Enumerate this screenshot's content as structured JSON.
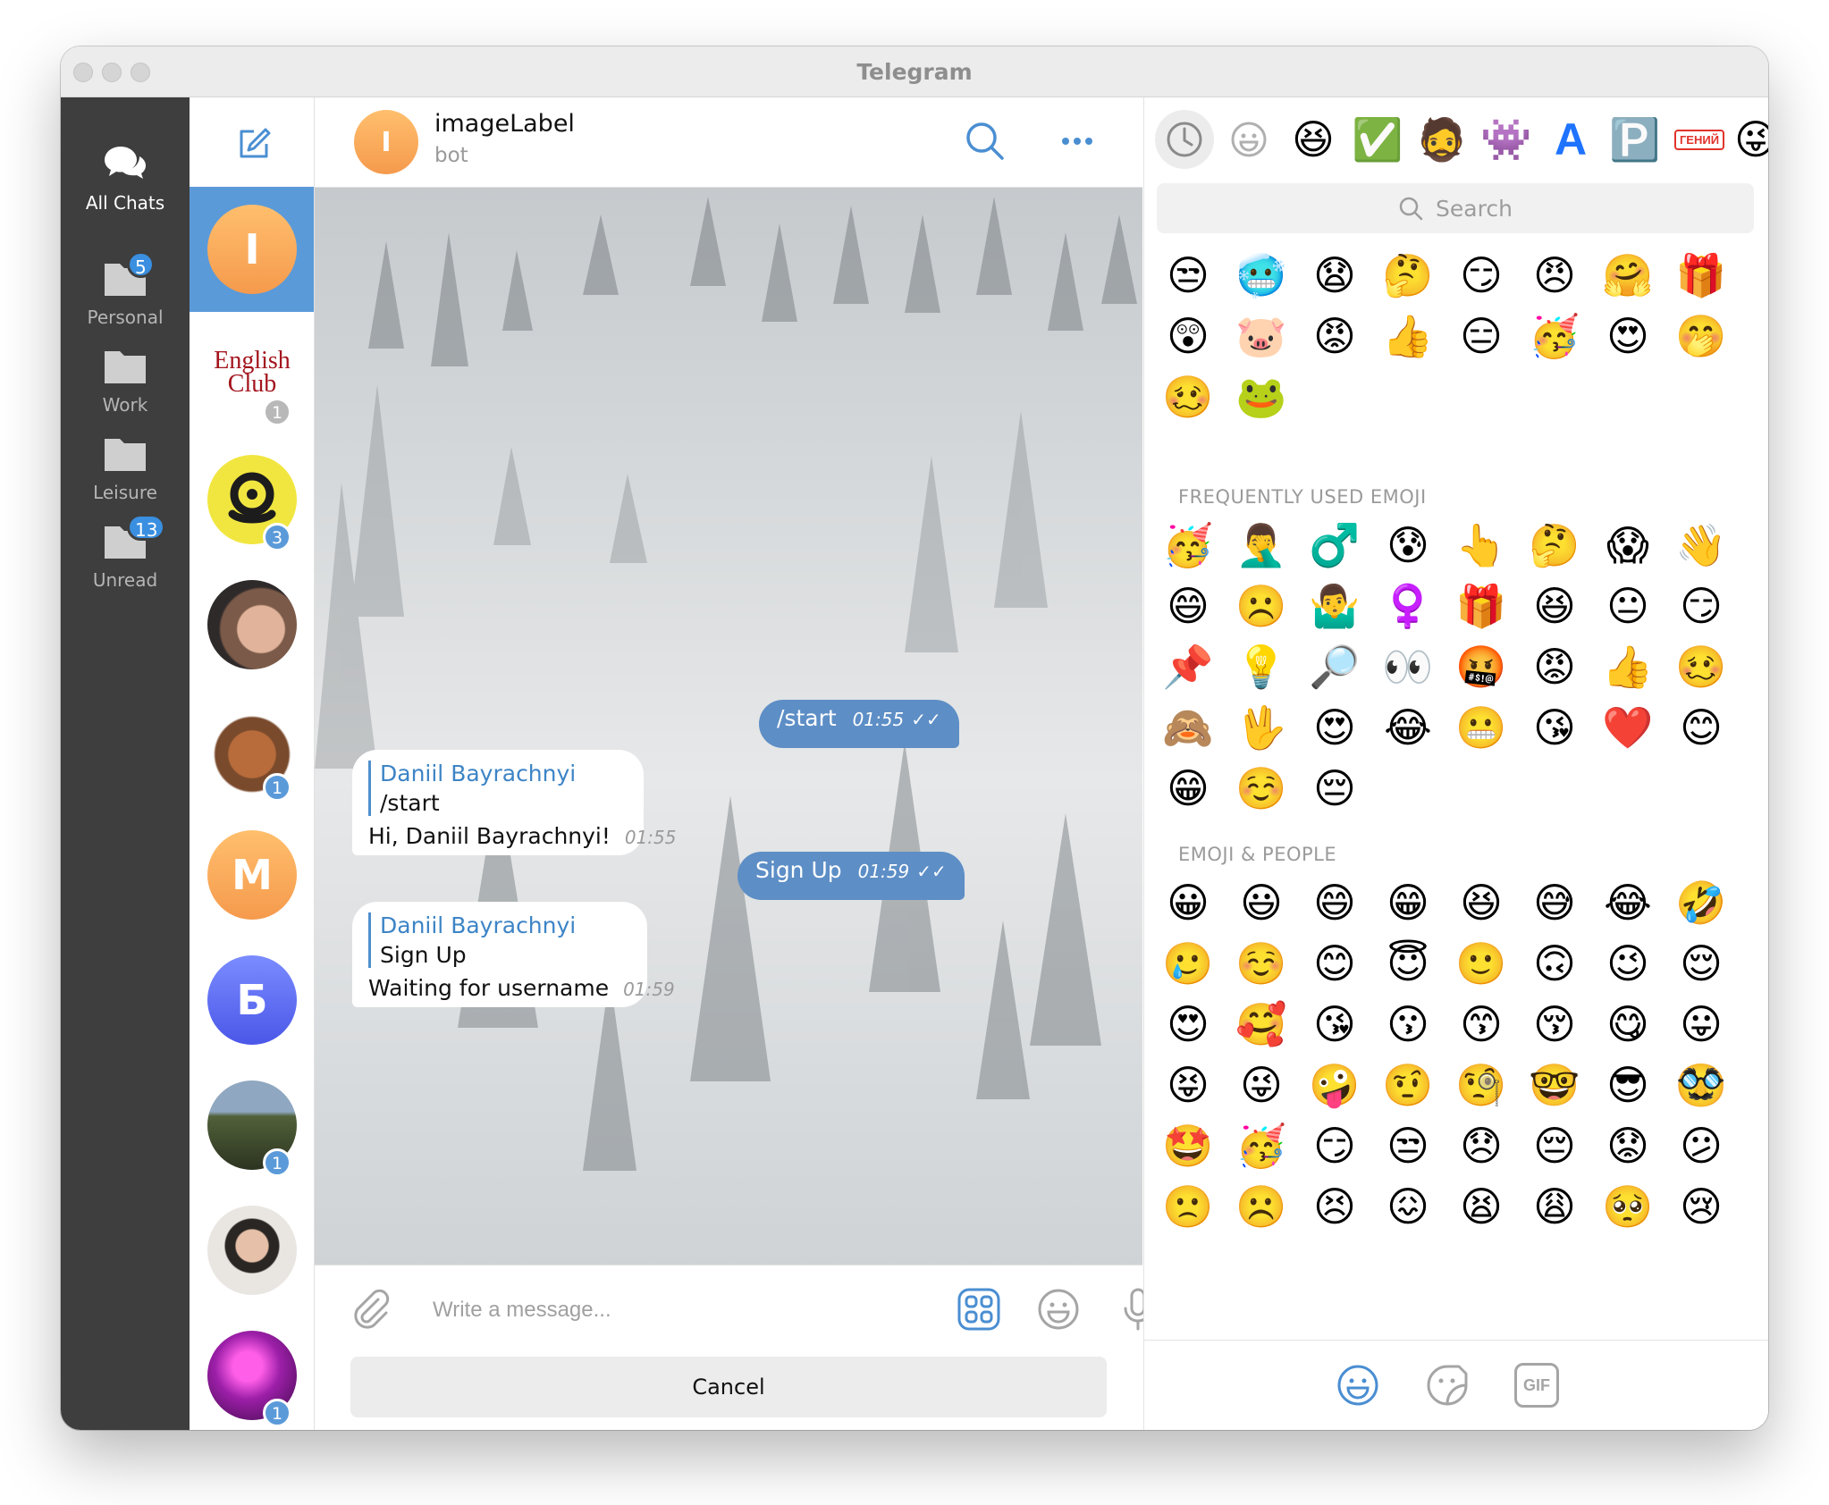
{
  "window": {
    "title": "Telegram"
  },
  "folders": [
    {
      "label": "All Chats",
      "badge": ""
    },
    {
      "label": "Personal",
      "badge": "5"
    },
    {
      "label": "Work",
      "badge": ""
    },
    {
      "label": "Leisure",
      "badge": ""
    },
    {
      "label": "Unread",
      "badge": "13"
    }
  ],
  "chats": [
    {
      "letter": "I",
      "badge": "",
      "color": "#f5a04f"
    },
    {
      "logo": "English Club",
      "badge": "1"
    },
    {
      "badge": "3"
    },
    {
      "badge": ""
    },
    {
      "badge": "1"
    },
    {
      "letter": "M",
      "badge": "",
      "color": "#f5a04f"
    },
    {
      "letter": "Б",
      "badge": "",
      "color": "#5d6ef0"
    },
    {
      "badge": "1"
    },
    {
      "badge": ""
    },
    {
      "badge": "1"
    }
  ],
  "chat": {
    "avatar_letter": "I",
    "name": "imageLabel",
    "status": "bot",
    "messages": [
      {
        "text": "/start",
        "time": "01:55"
      },
      {
        "reply_name": "Daniil Bayrachnyi",
        "reply_text": "/start",
        "text": "Hi, Daniil Bayrachnyi!",
        "time": "01:55"
      },
      {
        "text": "Sign Up",
        "time": "01:59"
      },
      {
        "reply_name": "Daniil Bayrachnyi",
        "reply_text": "Sign Up",
        "text": "Waiting for username",
        "time": "01:59"
      }
    ],
    "input_placeholder": "Write a message...",
    "cancel_label": "Cancel"
  },
  "emoji_panel": {
    "search_placeholder": "Search",
    "tabs": [
      "clock-icon",
      "smiley-outline-icon",
      "😆",
      "✅",
      "🧔",
      "👾",
      "A",
      "🅿️",
      "ГЕНИЙ",
      "😜"
    ],
    "sticker_rows": [
      [
        "😒",
        "🥶",
        "😧",
        "🤔",
        "😏",
        "😠",
        "🤗",
        "🎁"
      ],
      [
        "😲",
        "🐷",
        "😡",
        "👍",
        "😑",
        "🥳",
        "😍",
        "🤭"
      ],
      [
        "🥴",
        "🐸"
      ]
    ],
    "frequent_title": "FREQUENTLY USED EMOJI",
    "frequent": [
      [
        "🥳",
        "🤦‍♂️",
        "♂️",
        "😰",
        "👆",
        "🤔",
        "😱",
        "👋"
      ],
      [
        "😄",
        "☹️",
        "🤷‍♂️",
        "♀️",
        "🎁",
        "😆",
        "😐",
        "😏"
      ],
      [
        "📌",
        "💡",
        "🔎",
        "👀",
        "🤬",
        "😡",
        "👍",
        "🥴"
      ],
      [
        "🙈",
        "🖖",
        "😍",
        "😂",
        "😬",
        "😘",
        "❤️",
        "😊"
      ],
      [
        "😁",
        "☺️",
        "😔"
      ]
    ],
    "people_title": "EMOJI & PEOPLE",
    "people": [
      [
        "😀",
        "😃",
        "😄",
        "😁",
        "😆",
        "😅",
        "😂",
        "🤣"
      ],
      [
        "🥲",
        "☺️",
        "😊",
        "😇",
        "🙂",
        "🙃",
        "😉",
        "😌"
      ],
      [
        "😍",
        "🥰",
        "😘",
        "😗",
        "😙",
        "😚",
        "😋",
        "😛"
      ],
      [
        "😝",
        "😜",
        "🤪",
        "🤨",
        "🧐",
        "🤓",
        "😎",
        "🥸"
      ],
      [
        "🤩",
        "🥳",
        "😏",
        "😒",
        "😞",
        "😔",
        "😟",
        "😕"
      ],
      [
        "🙁",
        "☹️",
        "😣",
        "😖",
        "😫",
        "😩",
        "🥺",
        "😢"
      ],
      [
        "😭",
        "😤",
        "😠",
        "😡",
        "🤬",
        "🤯",
        "😳",
        "🥵"
      ],
      [
        "🥶",
        "😱",
        "😨",
        "😰",
        "😥",
        "😓",
        "🤗",
        "🤔"
      ],
      [
        "😶",
        "🤭",
        "🤫",
        "🤥",
        "😶",
        "😐",
        "😑",
        "😬"
      ]
    ],
    "bottom_tabs": [
      "emoji-tab-icon",
      "sticker-tab-icon",
      "GIF"
    ]
  }
}
